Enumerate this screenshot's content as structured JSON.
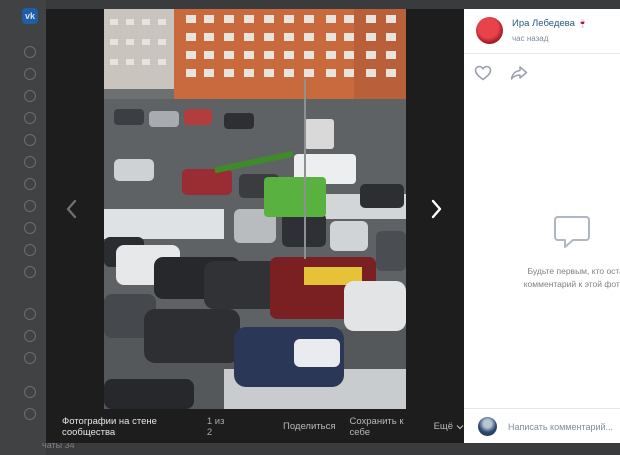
{
  "page": {
    "footer_text": "чаты 34"
  },
  "viewer": {
    "caption_title": "Фотографии на стене сообщества",
    "counter": "1 из 2",
    "share_label": "Поделиться",
    "save_label": "Сохранить к себе",
    "more_label": "Ещё",
    "prev_icon": "chevron-left-icon",
    "next_icon": "chevron-right-icon"
  },
  "photo": {
    "description_icon": "parking-lot-photo"
  },
  "author": {
    "name": "Ира Лебедева",
    "badge": "🍷",
    "time": "час назад"
  },
  "actions": {
    "like_icon": "heart-icon",
    "share_icon": "share-arrow-icon"
  },
  "comments": {
    "empty_line1": "Будьте первым, кто остав",
    "empty_line2": "комментарий к этой фотогр",
    "input_placeholder": "Написать комментарий..."
  },
  "colors": {
    "accent": "#2a5885",
    "panel_bg": "#ffffff",
    "viewer_bg": "#1d1d1e"
  }
}
